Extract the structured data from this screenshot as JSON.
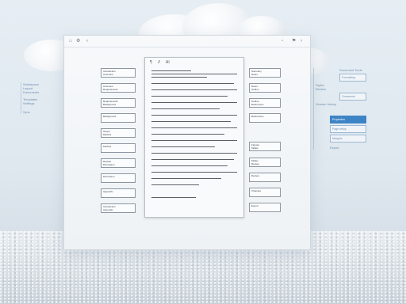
{
  "background": {
    "sky": "#e6eef4",
    "accent": "#3d84c6"
  },
  "left_panel": {
    "lines": [
      "Workspace",
      "Layout",
      "Documents",
      "Templates",
      "Settings",
      "Sync"
    ]
  },
  "right_panel": {
    "header": "Document Tools",
    "items": [
      "Formatting",
      "Styles",
      "Review",
      "Comments",
      "Version history"
    ],
    "active_label": "Properties",
    "fields": [
      "Page setup",
      "Margins"
    ],
    "footer": "Export"
  },
  "window": {
    "left_icons": [
      "home-icon",
      "settings-icon",
      "chevron-left-icon"
    ],
    "right_icons": [
      "save-icon",
      "bookmark-icon",
      "chevron-right-icon"
    ],
    "doc_toolbar": [
      "¶",
      "//",
      "AI"
    ]
  },
  "left_cards": [
    "Introduction",
    "Overview",
    "Requirements",
    "Background",
    "Scope",
    "Method",
    "Results",
    "Discussion",
    "Appendix"
  ],
  "right_cards": [
    "Summary",
    "Notes",
    "Outline",
    "References",
    "Figures",
    "Tables",
    "Review",
    "Changes",
    "Export"
  ]
}
